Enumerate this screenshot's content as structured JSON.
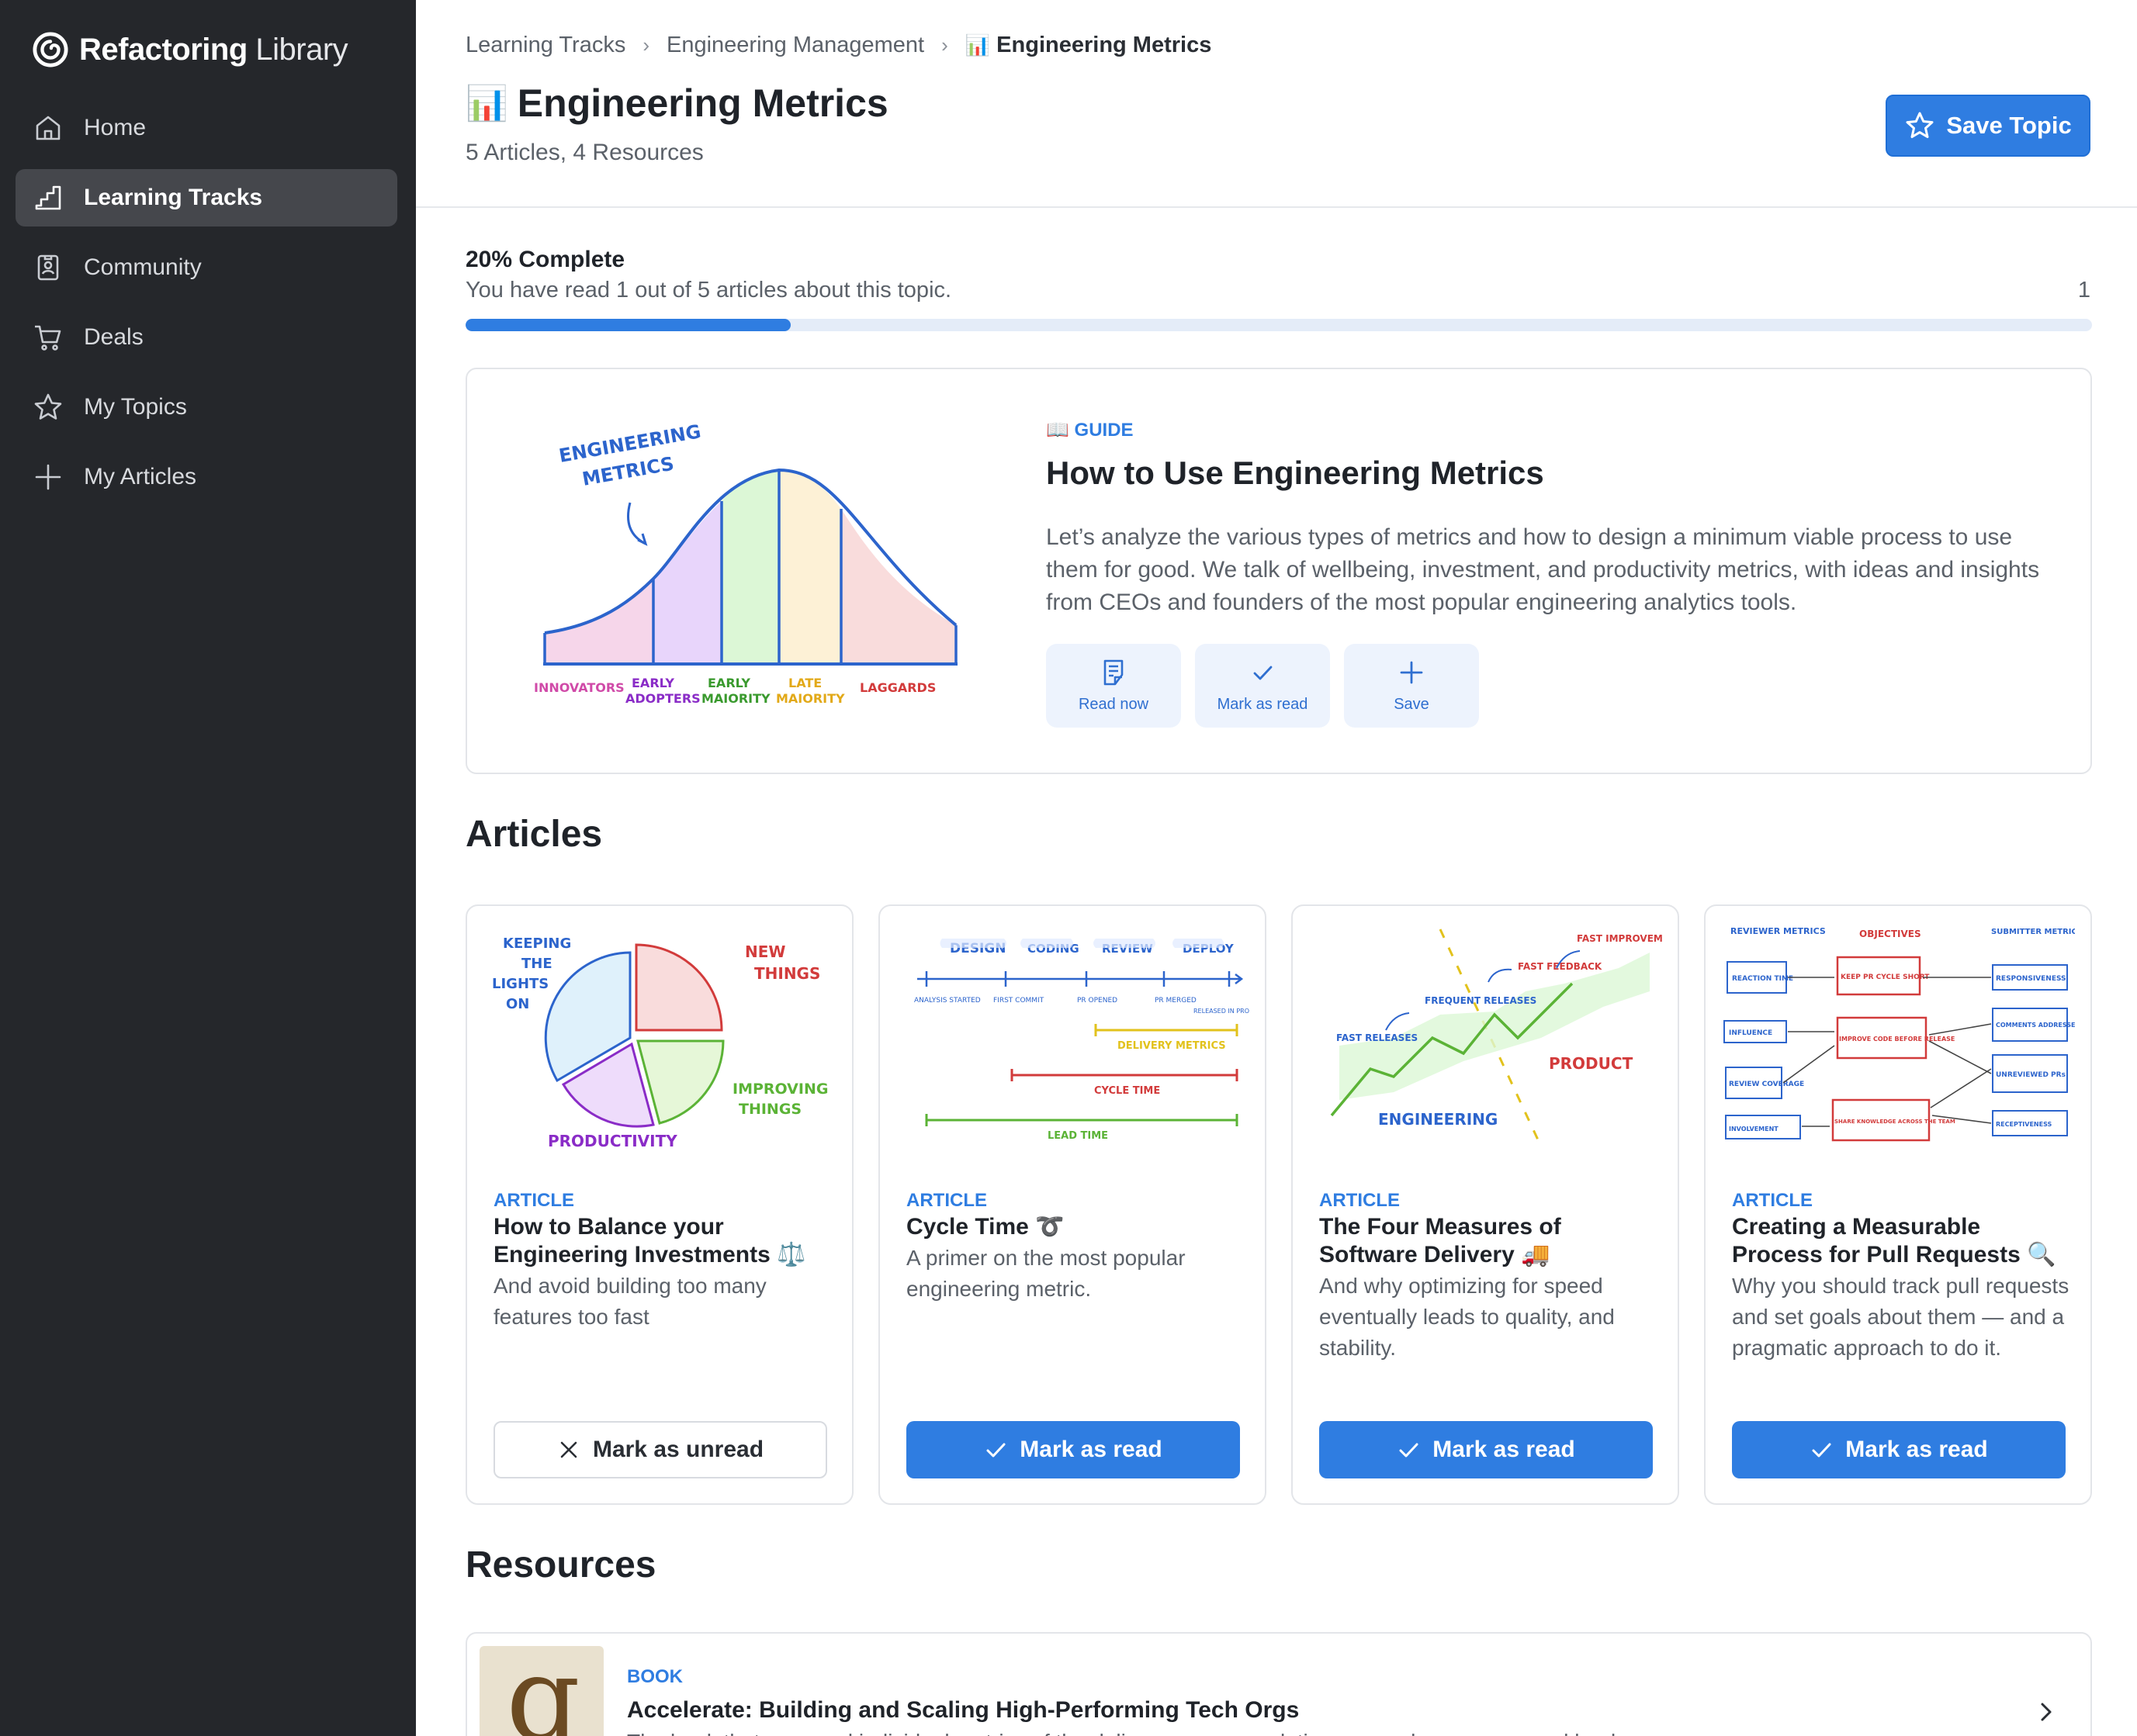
{
  "brand": {
    "name_bold": "Refactoring",
    "name_light": "Library"
  },
  "sidebar": {
    "items": [
      {
        "label": "Home",
        "icon": "home-icon",
        "active": false
      },
      {
        "label": "Learning Tracks",
        "icon": "stairs-icon",
        "active": true
      },
      {
        "label": "Community",
        "icon": "badge-icon",
        "active": false
      },
      {
        "label": "Deals",
        "icon": "cart-icon",
        "active": false
      },
      {
        "label": "My Topics",
        "icon": "star-icon",
        "active": false
      },
      {
        "label": "My Articles",
        "icon": "plus-icon",
        "active": false
      }
    ]
  },
  "breadcrumb": {
    "items": [
      "Learning Tracks",
      "Engineering Management",
      "Engineering Metrics"
    ],
    "current_emoji": "📊"
  },
  "header": {
    "emoji": "📊",
    "title": "Engineering Metrics",
    "subtitle": "5 Articles, 4 Resources",
    "save_label": "Save Topic"
  },
  "progress": {
    "title": "20% Complete",
    "description": "You have read 1 out of 5 articles about this topic.",
    "count": "1",
    "fraction": 0.2
  },
  "guide": {
    "kicker": "📖 GUIDE",
    "title": "How to Use Engineering Metrics",
    "description": "Let’s analyze the various types of metrics and how to design a minimum viable process to use them for good. We talk of wellbeing, investment, and productivity metrics, with ideas and insights from CEOs and founders of the most popular engineering analytics tools.",
    "image_labels": {
      "heading_1": "ENGINEERING",
      "heading_2": "METRICS",
      "innovators": "INNOVATORS",
      "early_adopters_1": "EARLY",
      "early_adopters_2": "ADOPTERS",
      "early_majority_1": "EARLY",
      "early_majority_2": "MAJORITY",
      "late_majority_1": "LATE",
      "late_majority_2": "MAJORITY",
      "laggards": "LAGGARDS"
    },
    "actions": [
      {
        "label": "Read now",
        "icon": "document-icon"
      },
      {
        "label": "Mark as read",
        "icon": "check-icon"
      },
      {
        "label": "Save",
        "icon": "plus-icon"
      }
    ]
  },
  "articles_heading": "Articles",
  "articles": [
    {
      "kicker": "ARTICLE",
      "title": "How to Balance your Engineering Investments ⚖️",
      "description": "And avoid building too many features too fast",
      "button": "Mark as unread",
      "button_style": "outline",
      "image_labels": [
        "KEEPING",
        "THE",
        "LIGHTS",
        "ON",
        "NEW",
        "THINGS",
        "IMPROVING",
        "THINGS",
        "PRODUCTIVITY"
      ]
    },
    {
      "kicker": "ARTICLE",
      "title": "Cycle Time ➰",
      "description": "A primer on the most popular engineering metric.",
      "button": "Mark as read",
      "button_style": "primary",
      "image_labels": [
        "DESIGN",
        "CODING",
        "REVIEW",
        "DEPLOY",
        "ANALYSIS STARTED",
        "FIRST COMMIT",
        "PR OPENED",
        "PR MERGED",
        "RELEASED IN PRODUCTION",
        "DELIVERY METRICS",
        "CYCLE TIME",
        "LEAD TIME"
      ]
    },
    {
      "kicker": "ARTICLE",
      "title": "The Four Measures of Software Delivery 🚚",
      "description": "And why optimizing for speed eventually leads to quality, and stability.",
      "button": "Mark as read",
      "button_style": "primary",
      "image_labels": [
        "FAST RELEASES",
        "FREQUENT RELEASES",
        "FAST FEEDBACK",
        "FAST IMPROVEMENTS",
        "PRODUCT",
        "ENGINEERING"
      ]
    },
    {
      "kicker": "ARTICLE",
      "title": "Creating a Measurable Process for Pull Requests 🔍",
      "description": "Why you should track pull requests and set goals about them — and a pragmatic approach to do it.",
      "button": "Mark as read",
      "button_style": "primary",
      "image_labels": [
        "REVIEWER METRICS",
        "OBJECTIVES",
        "SUBMITTER METRICS",
        "REACTION TIME",
        "KEEP PR CYCLE SHORT",
        "RESPONSIVENESS",
        "INFLUENCE",
        "IMPROVE CODE BEFORE RELEASE",
        "COMMENTS ADDRESSED",
        "REVIEW COVERAGE",
        "UNREVIEWED PRs",
        "INVOLVEMENT",
        "SHARE KNOWLEDGE ACROSS THE TEAM",
        "RECEPTIVENESS"
      ]
    }
  ],
  "resources_heading": "Resources",
  "resource": {
    "kicker": "BOOK",
    "title": "Accelerate: Building and Scaling High-Performing Tech Orgs",
    "description": "The book that spawned individual metrics of the delivery process, relating research, accuracy, and lead",
    "thumb_letter": "g"
  },
  "colors": {
    "accent": "#2f7de1",
    "sidebar_bg": "#25272b",
    "sidebar_active": "#45474c"
  }
}
